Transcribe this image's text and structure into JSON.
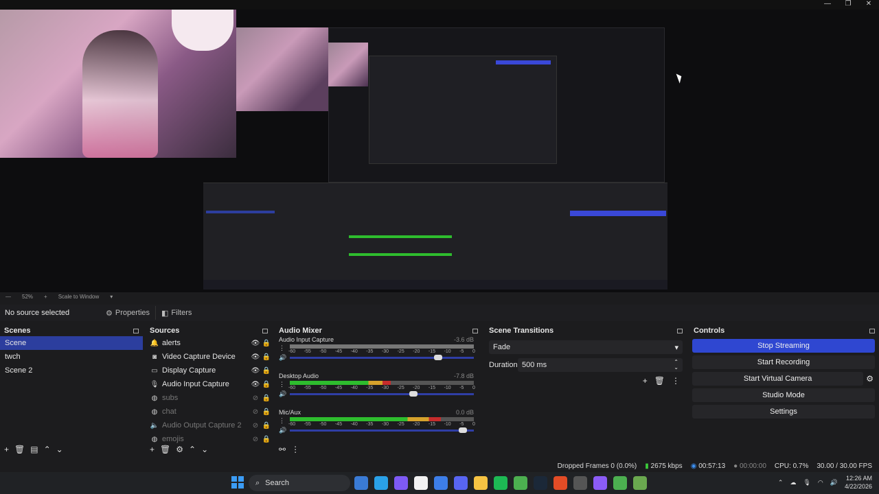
{
  "preview": {
    "zoom": "52%",
    "scale_mode": "Scale to Window"
  },
  "source_bar": {
    "no_source": "No source selected",
    "properties": "Properties",
    "filters": "Filters"
  },
  "scenes": {
    "title": "Scenes",
    "items": [
      "Scene",
      "twch",
      "Scene 2"
    ]
  },
  "sources": {
    "title": "Sources",
    "items": [
      {
        "icon": "alert-icon",
        "label": "alerts",
        "visible": true
      },
      {
        "icon": "camera-icon",
        "label": "Video Capture Device",
        "visible": true
      },
      {
        "icon": "monitor-icon",
        "label": "Display Capture",
        "visible": true
      },
      {
        "icon": "mic-icon",
        "label": "Audio Input Capture",
        "visible": true
      },
      {
        "icon": "globe-icon",
        "label": "subs",
        "visible": false
      },
      {
        "icon": "globe-icon",
        "label": "chat",
        "visible": false
      },
      {
        "icon": "speaker-icon",
        "label": "Audio Output Capture 2",
        "visible": false
      },
      {
        "icon": "globe-icon",
        "label": "emojis",
        "visible": false
      }
    ]
  },
  "mixer": {
    "title": "Audio Mixer",
    "scale": [
      "-60",
      "-55",
      "-50",
      "-45",
      "-40",
      "-35",
      "-30",
      "-25",
      "-20",
      "-15",
      "-10",
      "-5",
      "0"
    ],
    "channels": [
      {
        "name": "Audio Input Capture",
        "db": "-3.6 dB",
        "level": 0.0,
        "volume": 0.82,
        "muted": true
      },
      {
        "name": "Desktop Audio",
        "db": "-7.8 dB",
        "level": 0.55,
        "volume": 0.68,
        "muted": false
      },
      {
        "name": "Mic/Aux",
        "db": "0.0 dB",
        "level": 0.82,
        "volume": 0.96,
        "muted": false
      }
    ]
  },
  "transitions": {
    "title": "Scene Transitions",
    "selected": "Fade",
    "duration_label": "Duration",
    "duration_value": "500 ms"
  },
  "controls": {
    "title": "Controls",
    "buttons": [
      "Stop Streaming",
      "Start Recording",
      "Start Virtual Camera",
      "Studio Mode",
      "Settings"
    ]
  },
  "status": {
    "dropped": "Dropped Frames 0 (0.0%)",
    "bitrate": "2675 kbps",
    "stream_time": "00:57:13",
    "rec_time": "00:00:00",
    "cpu": "CPU: 0.7%",
    "fps": "30.00 / 30.00 FPS"
  },
  "taskbar": {
    "search": "Search",
    "time": "12:26 AM",
    "date": "4/22/2026",
    "colors": [
      "#3a7bd5",
      "#2aa1e8",
      "#7e5af5",
      "#f2f2f2",
      "#3d7ee8",
      "#5865f2",
      "#f6c343",
      "#1db954",
      "#4caf50",
      "#1b2838",
      "#e34c26",
      "#555555",
      "#8b5cf6",
      "#4caf50",
      "#6aa84f"
    ]
  }
}
